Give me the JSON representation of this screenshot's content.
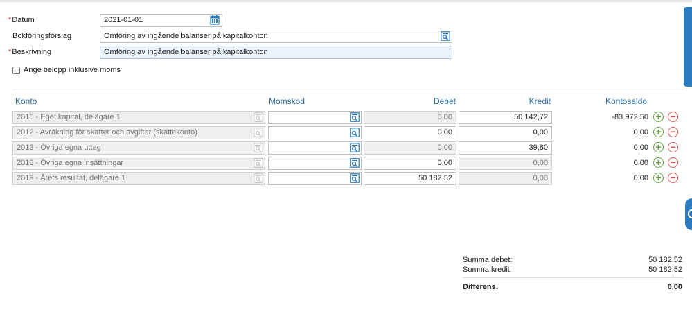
{
  "form": {
    "datum_label": "Datum",
    "datum_value": "2021-01-01",
    "forslag_label": "Bokföringsförslag",
    "forslag_value": "Omföring av ingående balanser på kapitalkonton",
    "beskrivning_label": "Beskrivning",
    "beskrivning_value": "Omföring av ingående balanser på kapitalkonton",
    "moms_checkbox_label": "Ange belopp inklusive moms",
    "moms_checked": false,
    "required_marker": "*"
  },
  "table": {
    "headers": {
      "konto": "Konto",
      "momskod": "Momskod",
      "debet": "Debet",
      "kredit": "Kredit",
      "kontosaldo": "Kontosaldo"
    },
    "rows": [
      {
        "konto": "2010 - Eget kapital, delägare 1",
        "momskod": "",
        "debet": "0,00",
        "kredit": "50 142,72",
        "saldo": "-83 972,50",
        "debet_editable": false,
        "kredit_editable": true
      },
      {
        "konto": "2012 - Avräkning för skatter och avgifter (skattekonto)",
        "momskod": "",
        "debet": "0,00",
        "kredit": "0,00",
        "saldo": "0,00",
        "debet_editable": true,
        "kredit_editable": true
      },
      {
        "konto": "2013 - Övriga egna uttag",
        "momskod": "",
        "debet": "0,00",
        "kredit": "39,80",
        "saldo": "0,00",
        "debet_editable": false,
        "kredit_editable": true
      },
      {
        "konto": "2018 - Övriga egna insättningar",
        "momskod": "",
        "debet": "0,00",
        "kredit": "0,00",
        "saldo": "0,00",
        "debet_editable": true,
        "kredit_editable": false
      },
      {
        "konto": "2019 - Årets resultat, delägare 1",
        "momskod": "",
        "debet": "50 182,52",
        "kredit": "0,00",
        "saldo": "0,00",
        "debet_editable": true,
        "kredit_editable": false
      }
    ],
    "add_symbol": "+",
    "remove_symbol": "−"
  },
  "summary": {
    "summa_debet_label": "Summa debet:",
    "summa_debet_value": "50 182,52",
    "summa_kredit_label": "Summa kredit:",
    "summa_kredit_value": "50 182,52",
    "differens_label": "Differens:",
    "differens_value": "0,00"
  },
  "icons": {
    "calendar": "calendar-icon",
    "lookup": "search-list-icon",
    "add": "add-row-icon",
    "remove": "remove-row-icon"
  },
  "colors": {
    "accent": "#2a6fa8",
    "icon_blue": "#1f74b8",
    "required": "#c0392b",
    "add": "#5ca33b",
    "remove": "#d9534f"
  }
}
